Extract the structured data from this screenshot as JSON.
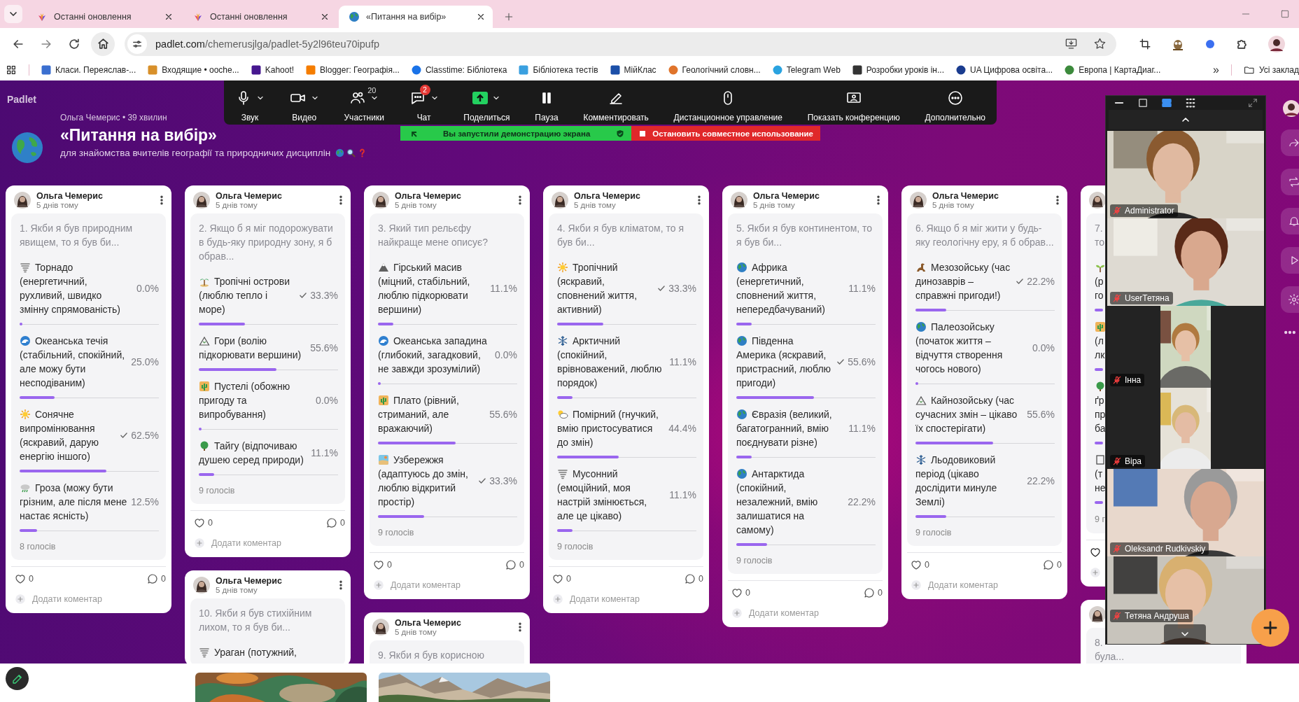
{
  "browser": {
    "tabs": [
      {
        "title": "Останні оновлення",
        "selected": false,
        "kind": "padlet"
      },
      {
        "title": "Останні оновлення",
        "selected": false,
        "kind": "padlet"
      },
      {
        "title": "«Питання на вибір»",
        "selected": true,
        "kind": "globe"
      }
    ],
    "address": {
      "host": "padlet.com",
      "path": "/chemerusjlga/padlet-5y2l96teu70ipufp"
    },
    "bookmarks": [
      {
        "label": "Класи. Переяслав-..."
      },
      {
        "label": "Входящие • ooche..."
      },
      {
        "label": "Kahoot!"
      },
      {
        "label": "Blogger: Географія..."
      },
      {
        "label": "Classtime: Бібліотека"
      },
      {
        "label": "Бібліотека тестів"
      },
      {
        "label": "МійКлас"
      },
      {
        "label": "Геологічний словн..."
      },
      {
        "label": "Telegram Web"
      },
      {
        "label": "Розробки уроків ін..."
      },
      {
        "label": "UA Цифрова освіта..."
      },
      {
        "label": "Европа | КартаДиаг..."
      }
    ],
    "more": "»",
    "folder": "Усі заклад"
  },
  "board": {
    "logo": "Padlet",
    "author_line": "Ольга Чемерис • 39 хвилин",
    "title": "«Питання на вибір»",
    "subtitle": "для знайомства вчителів географії та природничих дисциплін"
  },
  "columns": [
    {
      "cards": [
        {
          "author": "Ольга Чемерис",
          "time": "5 днів тому",
          "question": "1. Якби я був природним явищем, то я був би...",
          "options": [
            {
              "text": "Торнадо (енергетичний, рухливий, швидко змінну спрямованість)",
              "percent": "0.0%",
              "level": 0,
              "checked": false
            },
            {
              "text": "Океанська течія (стабільний, спокійний, але можу бути несподіваним)",
              "percent": "25.0%",
              "level": 0.25,
              "checked": false
            },
            {
              "text": "Сонячне випромінювання (яскравий, дарую енергію іншого)",
              "percent": "62.5%",
              "level": 0.625,
              "checked": true
            },
            {
              "text": "Гроза (можу бути грізним, але після мене настає ясність)",
              "percent": "12.5%",
              "level": 0.125,
              "checked": false
            }
          ],
          "votes": "8 голосів",
          "likes": "0",
          "comments": "0",
          "add_comment": "Додати коментар"
        }
      ]
    },
    {
      "cards": [
        {
          "author": "Ольга Чемерис",
          "time": "5 днів тому",
          "question": "2. Якщо б я міг подорожувати в будь-яку природну зону, я б обрав...",
          "options": [
            {
              "text": "Тропічні острови (люблю тепло і море)",
              "percent": "33.3%",
              "level": 0.333,
              "checked": true
            },
            {
              "text": "Гори (волію підкорювати вершини)",
              "percent": "55.6%",
              "level": 0.556,
              "checked": false
            },
            {
              "text": "Пустелі (обожню пригоду та випробування)",
              "percent": "0.0%",
              "level": 0,
              "checked": false
            },
            {
              "text": "Тайгу (відпочиваю душею серед природи)",
              "percent": "11.1%",
              "level": 0.111,
              "checked": false
            }
          ],
          "votes": "9 голосів",
          "likes": "0",
          "comments": "0",
          "add_comment": "Додати коментар"
        },
        {
          "author": "Ольга Чемерис",
          "time": "5 днів тому",
          "question": "10. Якби я був стихійним лихом, то я був би...",
          "options": [
            {
              "text": "Ураган (потужний,"
            }
          ]
        }
      ]
    },
    {
      "cards": [
        {
          "author": "Ольга Чемерис",
          "time": "5 днів тому",
          "question": "3. Який тип рельєфу найкраще мене описує?",
          "options": [
            {
              "text": "Гірський масив (міцний, стабільний, люблю підкорювати вершини)",
              "percent": "11.1%",
              "level": 0.111,
              "checked": false
            },
            {
              "text": "Океанська западина (глибокий, загадковий, не завжди зрозумілий)",
              "percent": "0.0%",
              "level": 0,
              "checked": false
            },
            {
              "text": "Плато (рівний, стриманий, але вражаючий)",
              "percent": "55.6%",
              "level": 0.556,
              "checked": false
            },
            {
              "text": "Узбережжя (адаптуюсь до змін, люблю відкритий простір)",
              "percent": "33.3%",
              "level": 0.333,
              "checked": true
            }
          ],
          "votes": "9 голосів",
          "likes": "0",
          "comments": "0",
          "add_comment": "Додати коментар"
        },
        {
          "author": "Ольга Чемерис",
          "time": "5 днів тому",
          "question": "9. Якби я був корисною"
        }
      ]
    },
    {
      "cards": [
        {
          "author": "Ольга Чемерис",
          "time": "5 днів тому",
          "question": "4. Якби я був кліматом, то я був би...",
          "options": [
            {
              "text": "Тропічний (яскравий, сповнений життя, активний)",
              "percent": "33.3%",
              "level": 0.333,
              "checked": true
            },
            {
              "text": "Арктичний (спокійний, врівноважений, люблю порядок)",
              "percent": "11.1%",
              "level": 0.111,
              "checked": false
            },
            {
              "text": "Помірний (гнучкий, вмію пристосуватися до змін)",
              "percent": "44.4%",
              "level": 0.444,
              "checked": false
            },
            {
              "text": "Мусонний (емоційний, моя настрій змінюється, але це цікаво)",
              "percent": "11.1%",
              "level": 0.111,
              "checked": false
            }
          ],
          "votes": "9 голосів",
          "likes": "0",
          "comments": "0",
          "add_comment": "Додати коментар"
        }
      ]
    },
    {
      "cards": [
        {
          "author": "Ольга Чемерис",
          "time": "5 днів тому",
          "question": "5. Якби я був континентом, то я був би...",
          "options": [
            {
              "text": "Африка (енергетичний, сповнений життя, непередбачуваний)",
              "percent": "11.1%",
              "level": 0.111,
              "checked": false
            },
            {
              "text": "Південна Америка (яскравий, пристрасний, люблю пригоди)",
              "percent": "55.6%",
              "level": 0.556,
              "checked": true
            },
            {
              "text": "Євразія (великий, багатогранний, вмію поєднувати різне)",
              "percent": "11.1%",
              "level": 0.111,
              "checked": false
            },
            {
              "text": "Антарктида (спокійний, незалежний, вмію залишатися на самому)",
              "percent": "22.2%",
              "level": 0.222,
              "checked": false
            }
          ],
          "votes": "9 голосів",
          "likes": "0",
          "comments": "0",
          "add_comment": "Додати коментар"
        }
      ]
    },
    {
      "cards": [
        {
          "author": "Ольга Чемерис",
          "time": "5 днів тому",
          "question": "6. Якщо б я міг жити у будь-яку геологічну еру, я б обрав...",
          "options": [
            {
              "text": "Мезозойську (час динозаврів – справжні пригоди!)",
              "percent": "22.2%",
              "level": 0.222,
              "checked": true
            },
            {
              "text": "Палеозойську (початок життя – відчуття створення чогось нового)",
              "percent": "0.0%",
              "level": 0,
              "checked": false
            },
            {
              "text": "Кайнозойську (час сучасних змін – цікаво їх спостерігати)",
              "percent": "55.6%",
              "level": 0.556,
              "checked": false
            },
            {
              "text": "Льодовиковий період (цікаво дослідити минуле Землі)",
              "percent": "22.2%",
              "level": 0.222,
              "checked": false
            }
          ],
          "votes": "9 голосів",
          "likes": "0",
          "comments": "0",
          "add_comment": "Додати коментар"
        }
      ]
    }
  ],
  "cut_column": {
    "cards": [
      {
        "question_lines": [
          "7.",
          "то"
        ],
        "options": [
          {
            "lines": [
              "(р",
              "го"
            ]
          },
          {
            "lines": [
              "(л",
              "лк"
            ]
          },
          {
            "lines": [
              "ґр",
              "пр",
              "ба"
            ]
          },
          {
            "lines": [
              "(т",
              "не"
            ]
          }
        ],
        "votes": "9 г"
      },
      {
        "question_lines": [
          "8.",
          "була..."
        ]
      }
    ]
  },
  "meeting_toolbar": {
    "items": [
      {
        "kind": "audio",
        "label": "Звук",
        "caret": true
      },
      {
        "kind": "video",
        "label": "Видео",
        "caret": true
      },
      {
        "kind": "participants",
        "label": "Участники",
        "caret": true,
        "count": "20"
      },
      {
        "kind": "chat",
        "label": "Чат",
        "caret": true,
        "badge": "2"
      },
      {
        "kind": "share",
        "label": "Поделиться",
        "caret": true
      },
      {
        "kind": "pause",
        "label": "Пауза",
        "caret": false
      },
      {
        "kind": "annotate",
        "label": "Комментировать",
        "caret": false
      },
      {
        "kind": "remote",
        "label": "Дистанционное управление",
        "caret": false
      },
      {
        "kind": "view",
        "label": "Показать конференцию",
        "caret": false
      },
      {
        "kind": "more",
        "label": "Дополнительно",
        "caret": false
      }
    ]
  },
  "share_banner": {
    "status": "Вы запустили демонстрацию экрана",
    "stop": "Остановить совместное использование"
  },
  "video_panel": {
    "tiles": [
      {
        "name": "Administrator",
        "muted": true,
        "kind": "wide"
      },
      {
        "name": "UserТетяна",
        "muted": true,
        "kind": "wide"
      },
      {
        "name": "Інна",
        "muted": true,
        "kind": "narrow"
      },
      {
        "name": "Віра",
        "muted": true,
        "kind": "narrow"
      },
      {
        "name": "Oleksandr Rudkivskiy",
        "muted": true,
        "kind": "wide"
      },
      {
        "name": "Тетяна Андруша",
        "muted": true,
        "kind": "wide"
      }
    ]
  }
}
